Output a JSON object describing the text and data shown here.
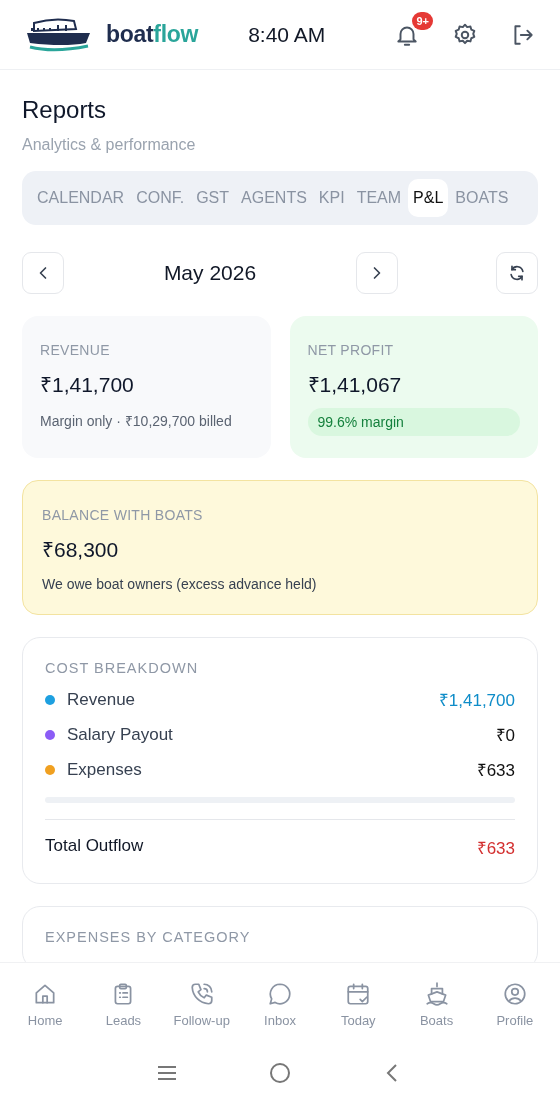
{
  "header": {
    "brand": "boat",
    "brand_accent": "flow",
    "time": "8:40 AM",
    "notification_badge": "9+"
  },
  "page": {
    "title": "Reports",
    "subtitle": "Analytics & performance"
  },
  "tabs": [
    {
      "label": "CALENDAR",
      "selected": false
    },
    {
      "label": "CONF.",
      "selected": false
    },
    {
      "label": "GST",
      "selected": false
    },
    {
      "label": "AGENTS",
      "selected": false
    },
    {
      "label": "KPI",
      "selected": false
    },
    {
      "label": "TEAM",
      "selected": false
    },
    {
      "label": "P&L",
      "selected": true
    },
    {
      "label": "BOATS",
      "selected": false
    }
  ],
  "period": {
    "label": "May 2026"
  },
  "summary_cards": [
    {
      "kind": "plain",
      "label": "REVENUE",
      "value": "₹1,41,700",
      "note": "Margin only · ₹10,29,700 billed"
    },
    {
      "kind": "positive",
      "label": "NET PROFIT",
      "value": "₹1,41,067",
      "pill": "99.6% margin"
    }
  ],
  "balance_card": {
    "label": "BALANCE WITH BOATS",
    "value": "₹68,300",
    "note": "We owe boat owners (excess advance held)"
  },
  "cost_breakdown": {
    "title": "COST BREAKDOWN",
    "items": [
      {
        "label": "Revenue",
        "value": "₹1,41,700",
        "color": "#1ea0e0",
        "highlight": true
      },
      {
        "label": "Salary Payout",
        "value": "₹0",
        "color": "#8b5cf6",
        "highlight": false
      },
      {
        "label": "Expenses",
        "value": "₹633",
        "color": "#f0a020",
        "highlight": false
      }
    ],
    "total_label": "Total Outflow",
    "total_value": "₹633"
  },
  "expenses_card": {
    "title": "EXPENSES BY CATEGORY"
  },
  "bottom_nav": [
    {
      "label": "Home",
      "kind": "home"
    },
    {
      "label": "Leads",
      "kind": "clipboard"
    },
    {
      "label": "Follow-up",
      "kind": "phone"
    },
    {
      "label": "Inbox",
      "kind": "chat"
    },
    {
      "label": "Today",
      "kind": "calendar"
    },
    {
      "label": "Boats",
      "kind": "ship"
    },
    {
      "label": "Profile",
      "kind": "user"
    }
  ]
}
